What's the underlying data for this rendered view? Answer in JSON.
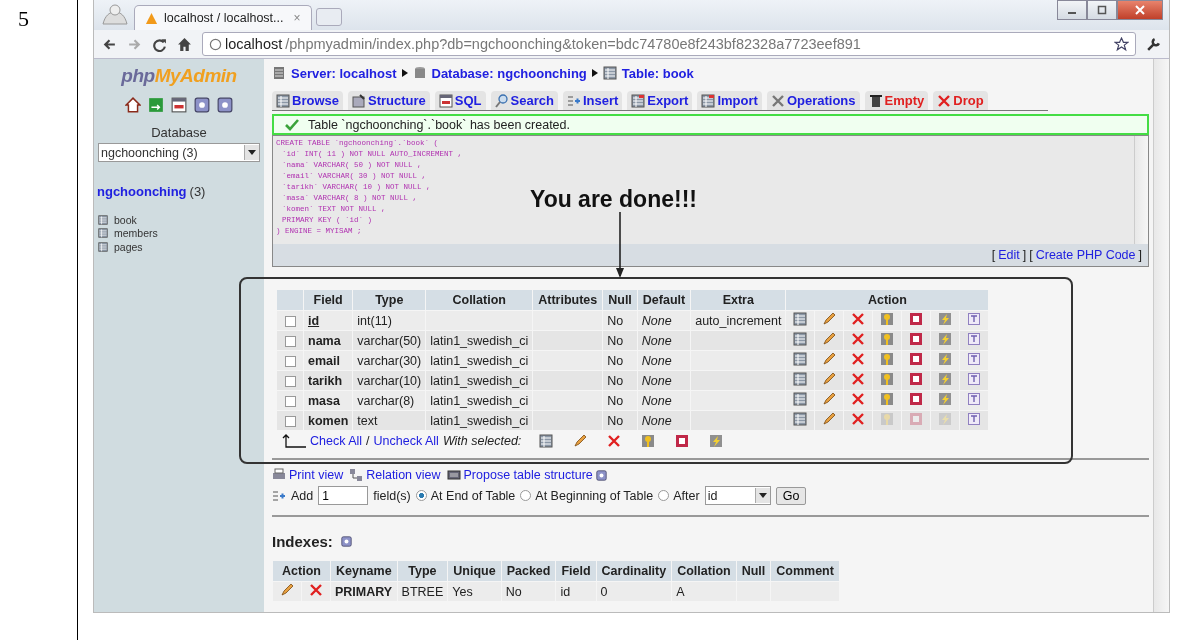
{
  "document": {
    "step": "5"
  },
  "browser": {
    "tab": {
      "title": "localhost / localhost...",
      "close": "×"
    },
    "address": {
      "host": "localhost",
      "path": "/phpmyadmin/index.php?db=ngchoonching&token=bdc74780e8f243bf82328a7723eef891"
    }
  },
  "sidebar": {
    "logo": {
      "part1": "php",
      "part2": "MyAdmin"
    },
    "icons": [
      {
        "kind": "home"
      },
      {
        "kind": "exit"
      },
      {
        "kind": "sql"
      },
      {
        "kind": "help"
      },
      {
        "kind": "docs"
      }
    ],
    "database_label": "Database",
    "database_select": "ngchoonching (3)",
    "database_link": "ngchoonching",
    "database_count": "(3)",
    "tables": [
      "book",
      "members",
      "pages"
    ]
  },
  "breadcrumb": [
    {
      "kind": "server",
      "label": "Server: localhost"
    },
    {
      "kind": "database",
      "label": "Database: ngchoonching"
    },
    {
      "kind": "table",
      "label": "Table: book"
    }
  ],
  "tabs": [
    {
      "kind": "browse",
      "label": "Browse",
      "danger": false
    },
    {
      "kind": "structure",
      "label": "Structure",
      "danger": false
    },
    {
      "kind": "sql",
      "label": "SQL",
      "danger": false
    },
    {
      "kind": "search",
      "label": "Search",
      "danger": false
    },
    {
      "kind": "insert",
      "label": "Insert",
      "danger": false
    },
    {
      "kind": "export",
      "label": "Export",
      "danger": false
    },
    {
      "kind": "import",
      "label": "Import",
      "danger": false
    },
    {
      "kind": "operations",
      "label": "Operations",
      "danger": false
    },
    {
      "kind": "empty",
      "label": "Empty",
      "danger": true
    },
    {
      "kind": "drop",
      "label": "Drop",
      "danger": true
    }
  ],
  "notice": "Table `ngchoonching`.`book` has been created.",
  "sql": [
    "CREATE TABLE `ngchoonching`.`book` (",
    "`id` INT( 11 ) NOT NULL AUTO_INCREMENT ,",
    "`nama` VARCHAR( 50 ) NOT NULL ,",
    "`email` VARCHAR( 30 ) NOT NULL ,",
    "`tarikh` VARCHAR( 10 ) NOT NULL ,",
    "`masa` VARCHAR( 8 ) NOT NULL ,",
    "`komen` TEXT NOT NULL ,",
    "PRIMARY KEY ( `id` )",
    ") ENGINE = MYISAM ;"
  ],
  "sql_links": [
    {
      "open": "[",
      "label": "Edit",
      "close": "]"
    },
    {
      "open": "[",
      "label": "Create PHP Code",
      "close": "]"
    }
  ],
  "annotation": "You are done!!!",
  "structure": {
    "columns": [
      "Field",
      "Type",
      "Collation",
      "Attributes",
      "Null",
      "Default",
      "Extra",
      "Action"
    ],
    "rows": [
      {
        "checked": false,
        "field": "id",
        "primary": true,
        "type": "int(11)",
        "null": "No",
        "default": "None",
        "extra": "auto_increment",
        "actions": [
          {
            "kind": "browse",
            "disabled": false
          },
          {
            "kind": "change",
            "disabled": false
          },
          {
            "kind": "drop",
            "disabled": false
          },
          {
            "kind": "primary",
            "disabled": false
          },
          {
            "kind": "unique",
            "disabled": false
          },
          {
            "kind": "index",
            "disabled": false
          },
          {
            "kind": "fulltext",
            "disabled": false
          }
        ]
      },
      {
        "checked": false,
        "field": "nama",
        "primary": false,
        "type": "varchar(50)",
        "collation": "latin1_swedish_ci",
        "null": "No",
        "default": "None",
        "actions": [
          {
            "kind": "browse",
            "disabled": false
          },
          {
            "kind": "change",
            "disabled": false
          },
          {
            "kind": "drop",
            "disabled": false
          },
          {
            "kind": "primary",
            "disabled": false
          },
          {
            "kind": "unique",
            "disabled": false
          },
          {
            "kind": "index",
            "disabled": false
          },
          {
            "kind": "fulltext",
            "disabled": false
          }
        ]
      },
      {
        "checked": false,
        "field": "email",
        "primary": false,
        "type": "varchar(30)",
        "collation": "latin1_swedish_ci",
        "null": "No",
        "default": "None",
        "actions": [
          {
            "kind": "browse",
            "disabled": false
          },
          {
            "kind": "change",
            "disabled": false
          },
          {
            "kind": "drop",
            "disabled": false
          },
          {
            "kind": "primary",
            "disabled": false
          },
          {
            "kind": "unique",
            "disabled": false
          },
          {
            "kind": "index",
            "disabled": false
          },
          {
            "kind": "fulltext",
            "disabled": false
          }
        ]
      },
      {
        "checked": false,
        "field": "tarikh",
        "primary": false,
        "type": "varchar(10)",
        "collation": "latin1_swedish_ci",
        "null": "No",
        "default": "None",
        "actions": [
          {
            "kind": "browse",
            "disabled": false
          },
          {
            "kind": "change",
            "disabled": false
          },
          {
            "kind": "drop",
            "disabled": false
          },
          {
            "kind": "primary",
            "disabled": false
          },
          {
            "kind": "unique",
            "disabled": false
          },
          {
            "kind": "index",
            "disabled": false
          },
          {
            "kind": "fulltext",
            "disabled": false
          }
        ]
      },
      {
        "checked": false,
        "field": "masa",
        "primary": false,
        "type": "varchar(8)",
        "collation": "latin1_swedish_ci",
        "null": "No",
        "default": "None",
        "actions": [
          {
            "kind": "browse",
            "disabled": false
          },
          {
            "kind": "change",
            "disabled": false
          },
          {
            "kind": "drop",
            "disabled": false
          },
          {
            "kind": "primary",
            "disabled": false
          },
          {
            "kind": "unique",
            "disabled": false
          },
          {
            "kind": "index",
            "disabled": false
          },
          {
            "kind": "fulltext",
            "disabled": false
          }
        ]
      },
      {
        "checked": false,
        "field": "komen",
        "primary": false,
        "type": "text",
        "collation": "latin1_swedish_ci",
        "null": "No",
        "default": "None",
        "actions": [
          {
            "kind": "browse",
            "disabled": false
          },
          {
            "kind": "change",
            "disabled": false
          },
          {
            "kind": "drop",
            "disabled": false
          },
          {
            "kind": "primary",
            "disabled": true
          },
          {
            "kind": "unique",
            "disabled": true
          },
          {
            "kind": "index",
            "disabled": true
          },
          {
            "kind": "fulltext",
            "disabled": false
          }
        ]
      }
    ]
  },
  "footer": {
    "check_all": "Check All",
    "separator": "/",
    "uncheck_all": "Uncheck All",
    "with_selected": "With selected:",
    "bulk_actions": [
      {
        "kind": "browse"
      },
      {
        "kind": "change"
      },
      {
        "kind": "drop"
      },
      {
        "kind": "primary"
      },
      {
        "kind": "unique"
      },
      {
        "kind": "index"
      }
    ]
  },
  "links": [
    {
      "kind": "print",
      "label": "Print view",
      "help": false
    },
    {
      "kind": "relation",
      "label": "Relation view",
      "help": false
    },
    {
      "kind": "propose",
      "label": "Propose table structure",
      "help": true
    }
  ],
  "add_field": {
    "label": "Add",
    "value": "1",
    "unit": "field(s)",
    "positions": [
      {
        "label": "At End of Table",
        "selected": true
      },
      {
        "label": "At Beginning of Table",
        "selected": false
      },
      {
        "label": "After",
        "selected": false
      }
    ],
    "after": "id",
    "button": "Go"
  },
  "indexes": {
    "title": "Indexes:",
    "columns": [
      "Action",
      "Keyname",
      "Type",
      "Unique",
      "Packed",
      "Field",
      "Cardinality",
      "Collation",
      "Null",
      "Comment"
    ],
    "rows": [
      {
        "actions": [
          {
            "kind": "change"
          },
          {
            "kind": "drop"
          }
        ],
        "keyname": "PRIMARY",
        "type": "BTREE",
        "unique": "Yes",
        "packed": "No",
        "field": "id",
        "cardinality": "0",
        "collation": "A"
      }
    ]
  }
}
